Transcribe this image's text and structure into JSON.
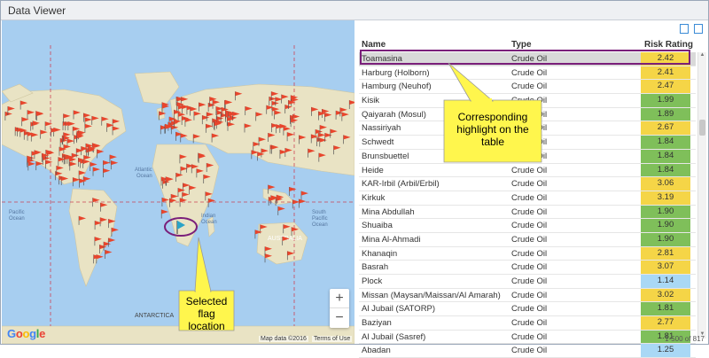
{
  "window": {
    "title": "Data Viewer"
  },
  "map": {
    "ocean_labels": [
      "North Pacific Ocean",
      "Atlantic Ocean",
      "Indian Ocean",
      "South Pacific Ocean"
    ],
    "land_labels": [
      "AUSTRALIA",
      "ANTARCTICA"
    ],
    "zoom_in": "+",
    "zoom_out": "−",
    "google_logo": "Google",
    "attribution": "Map data ©2016",
    "terms": "Terms of Use"
  },
  "table": {
    "columns": [
      "Name",
      "Type",
      "Risk Rating"
    ],
    "rows": [
      {
        "name": "Toamasina",
        "type": "Crude Oil",
        "risk": "2.42",
        "color": "#f5d547"
      },
      {
        "name": "Harburg (Holborn)",
        "type": "Crude Oil",
        "risk": "2.41",
        "color": "#f5d547"
      },
      {
        "name": "Hamburg (Neuhof)",
        "type": "Crude Oil",
        "risk": "2.47",
        "color": "#f5d547"
      },
      {
        "name": "Kisik",
        "type": "Crude Oil",
        "risk": "1.99",
        "color": "#7fbf5a"
      },
      {
        "name": "Qaiyarah (Mosul)",
        "type": "Crude Oil",
        "risk": "1.89",
        "color": "#7fbf5a"
      },
      {
        "name": "Nassiriyah",
        "type": "Crude Oil",
        "risk": "2.67",
        "color": "#f5d547"
      },
      {
        "name": "Schwedt",
        "type": "Crude Oil",
        "risk": "1.84",
        "color": "#7fbf5a"
      },
      {
        "name": "Brunsbuettel",
        "type": "Crude Oil",
        "risk": "1.84",
        "color": "#7fbf5a"
      },
      {
        "name": "Heide",
        "type": "Crude Oil",
        "risk": "1.84",
        "color": "#7fbf5a"
      },
      {
        "name": "KAR-Irbil (Arbil/Erbil)",
        "type": "Crude Oil",
        "risk": "3.06",
        "color": "#f5d547"
      },
      {
        "name": "Kirkuk",
        "type": "Crude Oil",
        "risk": "3.19",
        "color": "#f5d547"
      },
      {
        "name": "Mina Abdullah",
        "type": "Crude Oil",
        "risk": "1.90",
        "color": "#7fbf5a"
      },
      {
        "name": "Shuaiba",
        "type": "Crude Oil",
        "risk": "1.90",
        "color": "#7fbf5a"
      },
      {
        "name": "Mina Al-Ahmadi",
        "type": "Crude Oil",
        "risk": "1.90",
        "color": "#7fbf5a"
      },
      {
        "name": "Khanaqin",
        "type": "Crude Oil",
        "risk": "2.81",
        "color": "#f5d547"
      },
      {
        "name": "Basrah",
        "type": "Crude Oil",
        "risk": "3.07",
        "color": "#f5d547"
      },
      {
        "name": "Plock",
        "type": "Crude Oil",
        "risk": "1.14",
        "color": "#a9d8f5"
      },
      {
        "name": "Missan (Maysan/Maissan/Al Amarah)",
        "type": "Crude Oil",
        "risk": "3.02",
        "color": "#f5d547"
      },
      {
        "name": "Al Jubail (SATORP)",
        "type": "Crude Oil",
        "risk": "1.81",
        "color": "#7fbf5a"
      },
      {
        "name": "Baziyan",
        "type": "Crude Oil",
        "risk": "2.77",
        "color": "#f5d547"
      },
      {
        "name": "Al Jubail (Sasref)",
        "type": "Crude Oil",
        "risk": "1.81",
        "color": "#7fbf5a"
      },
      {
        "name": "Abadan",
        "type": "Crude Oil",
        "risk": "1.25",
        "color": "#a9d8f5"
      }
    ],
    "pagination": "1-500 of 817"
  },
  "callouts": {
    "table_callout": [
      "Corresponding",
      "highlight on the",
      "table"
    ],
    "map_callout": [
      "Selected flag",
      "location"
    ]
  },
  "colors": {
    "flag": "#e8452c",
    "callout_fill": "#fff64d",
    "highlight_border": "#7a1f7a",
    "selected_flag": "#2aa3c7"
  }
}
